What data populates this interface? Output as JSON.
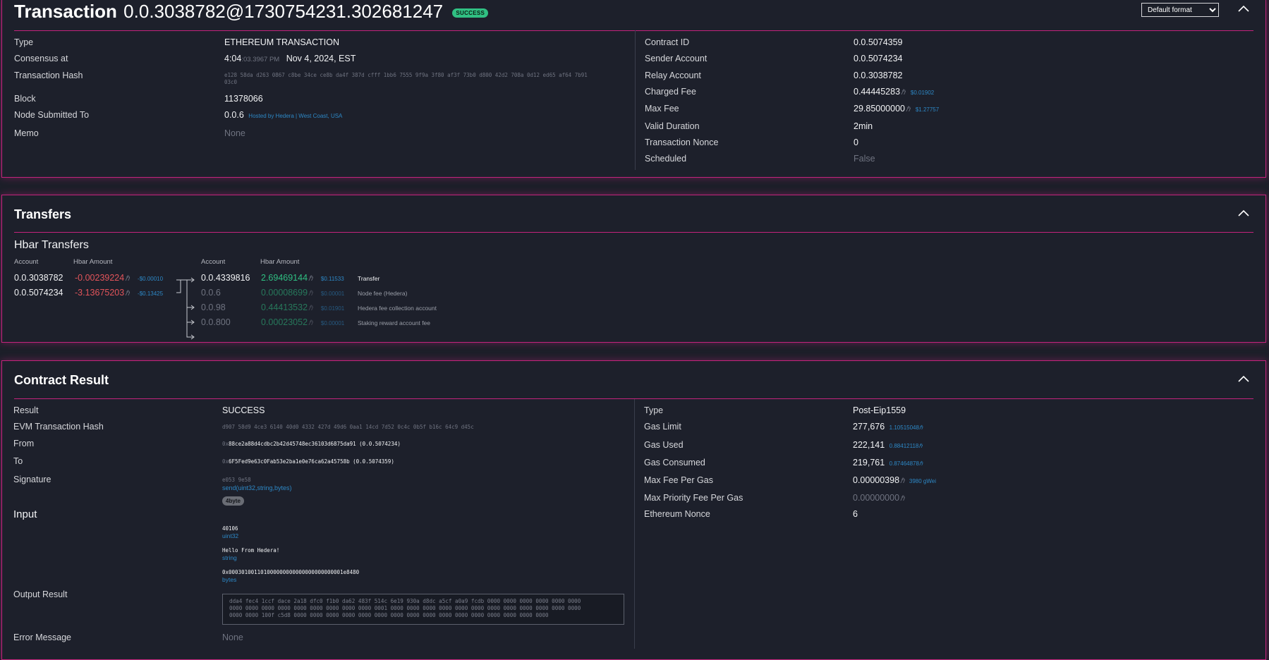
{
  "transaction_card": {
    "title": "Transaction",
    "transaction_id": "0.0.3038782@1730754231.302681247",
    "status_badge": "SUCCESS",
    "format_select": "Default format",
    "left": {
      "type_label": "Type",
      "type_value": "ETHEREUM TRANSACTION",
      "consensus_label": "Consensus at",
      "consensus_time": "4:04",
      "consensus_time_frac": ":03.3967 PM",
      "consensus_date": "Nov 4, 2024, EST",
      "hash_label": "Transaction Hash",
      "hash_value_line1": "e128 58da d263 0867 c8be 34ce ce8b da4f 387d cfff 1bb6 7555 9f9a 3f80 af3f 73b0 d800 42d2 708a 0d12 ed65 af64 7b91",
      "hash_value_line2": "03c0",
      "block_label": "Block",
      "block_value": "11378066",
      "node_label": "Node Submitted To",
      "node_value": "0.0.6",
      "node_hosted": "Hosted by Hedera | West Coast, USA",
      "memo_label": "Memo",
      "memo_value": "None"
    },
    "right": {
      "contract_label": "Contract ID",
      "contract_value": "0.0.5074359",
      "sender_label": "Sender Account",
      "sender_value": "0.0.5074234",
      "relay_label": "Relay Account",
      "relay_value": "0.0.3038782",
      "charged_label": "Charged Fee",
      "charged_value": "0.44445283",
      "charged_usd": "$0.01902",
      "maxfee_label": "Max Fee",
      "maxfee_value": "29.85000000",
      "maxfee_usd": "$1.27757",
      "duration_label": "Valid Duration",
      "duration_value": "2min",
      "nonce_label": "Transaction Nonce",
      "nonce_value": "0",
      "scheduled_label": "Scheduled",
      "scheduled_value": "False"
    }
  },
  "transfers_card": {
    "title": "Transfers",
    "subtitle": "Hbar Transfers",
    "col_account": "Account",
    "col_amount": "Hbar Amount",
    "hbar_symbol": "ℏ",
    "from": [
      {
        "account": "0.0.3038782",
        "amount": "-0.00239224",
        "usd": "-$0.00010"
      },
      {
        "account": "0.0.5074234",
        "amount": "-3.13675203",
        "usd": "-$0.13425"
      }
    ],
    "to": [
      {
        "account": "0.0.4339816",
        "amount": "2.69469144",
        "usd": "$0.11533",
        "desc": "Transfer"
      },
      {
        "account": "0.0.6",
        "amount": "0.00008699",
        "usd": "$0.00001",
        "desc": "Node fee (Hedera)"
      },
      {
        "account": "0.0.98",
        "amount": "0.44413532",
        "usd": "$0.01901",
        "desc": "Hedera fee collection account"
      },
      {
        "account": "0.0.800",
        "amount": "0.00023052",
        "usd": "$0.00001",
        "desc": "Staking reward account fee"
      }
    ]
  },
  "contract_card": {
    "title": "Contract Result",
    "left": {
      "result_label": "Result",
      "result_value": "SUCCESS",
      "evm_hash_label": "EVM Transaction Hash",
      "evm_hash_value": "d907 58d9 4ce3 6140 40d0 4332 427d 49d6 0aa1 14cd 7d52 0c4c 0b5f b16c 64c9 d45c",
      "from_label": "From",
      "from_prefix": "0x",
      "from_value": "88ce2a88d4cdbc2b42d45748ec36103d6875da91",
      "from_id": "(0.0.5074234)",
      "to_label": "To",
      "to_prefix": "0x",
      "to_value": "6F5Fed9e63c0Fab53e2ba1e0e76ca62a45758b",
      "to_id": "(0.0.5074359)",
      "signature_label": "Signature",
      "signature_hex": "e053 9e58",
      "signature_func": "send(uint32,string,bytes)",
      "signature_badge": "4byte",
      "input_title": "Input",
      "inputs": [
        {
          "value": "40106",
          "type": "uint32"
        },
        {
          "value": "Hello From Hedera!",
          "type": "string"
        },
        {
          "value": "0x000301001101000000000000000000000001e8480",
          "type": "bytes"
        }
      ],
      "output_label": "Output Result",
      "output_lines": [
        "dda4 fec4 1ccf dace 2a18 dfc0 f1b0 da62 483f 514c 6e19 930a d8dc a5cf a0a9 fcdb 0000 0000 0000 0000 0000 0000",
        "0000 0000 0000 0000 0000 0000 0000 0000 0000 0001 0000 0000 0000 0000 0000 0000 0000 0000 0000 0000 0000 0000",
        "0000 0000 100f c5d8 0000 0000 0000 0000 0000 0000 0000 0000 0000 0000 0000 0000 0000 0000 0000 0000"
      ],
      "error_label": "Error Message",
      "error_value": "None"
    },
    "right": {
      "type_label": "Type",
      "type_value": "Post-Eip1559",
      "gas_limit_label": "Gas Limit",
      "gas_limit_value": "277,676",
      "gas_limit_sub": "1.10515048",
      "gas_used_label": "Gas Used",
      "gas_used_value": "222,141",
      "gas_used_sub": "0.88412118",
      "gas_consumed_label": "Gas Consumed",
      "gas_consumed_value": "219,761",
      "gas_consumed_sub": "0.87464878",
      "max_fee_label": "Max Fee Per Gas",
      "max_fee_value": "0.00000398",
      "max_fee_sub": "3980 gWei",
      "max_priority_label": "Max Priority Fee Per Gas",
      "max_priority_value": "0.00000000",
      "eth_nonce_label": "Ethereum Nonce",
      "eth_nonce_value": "6"
    }
  }
}
